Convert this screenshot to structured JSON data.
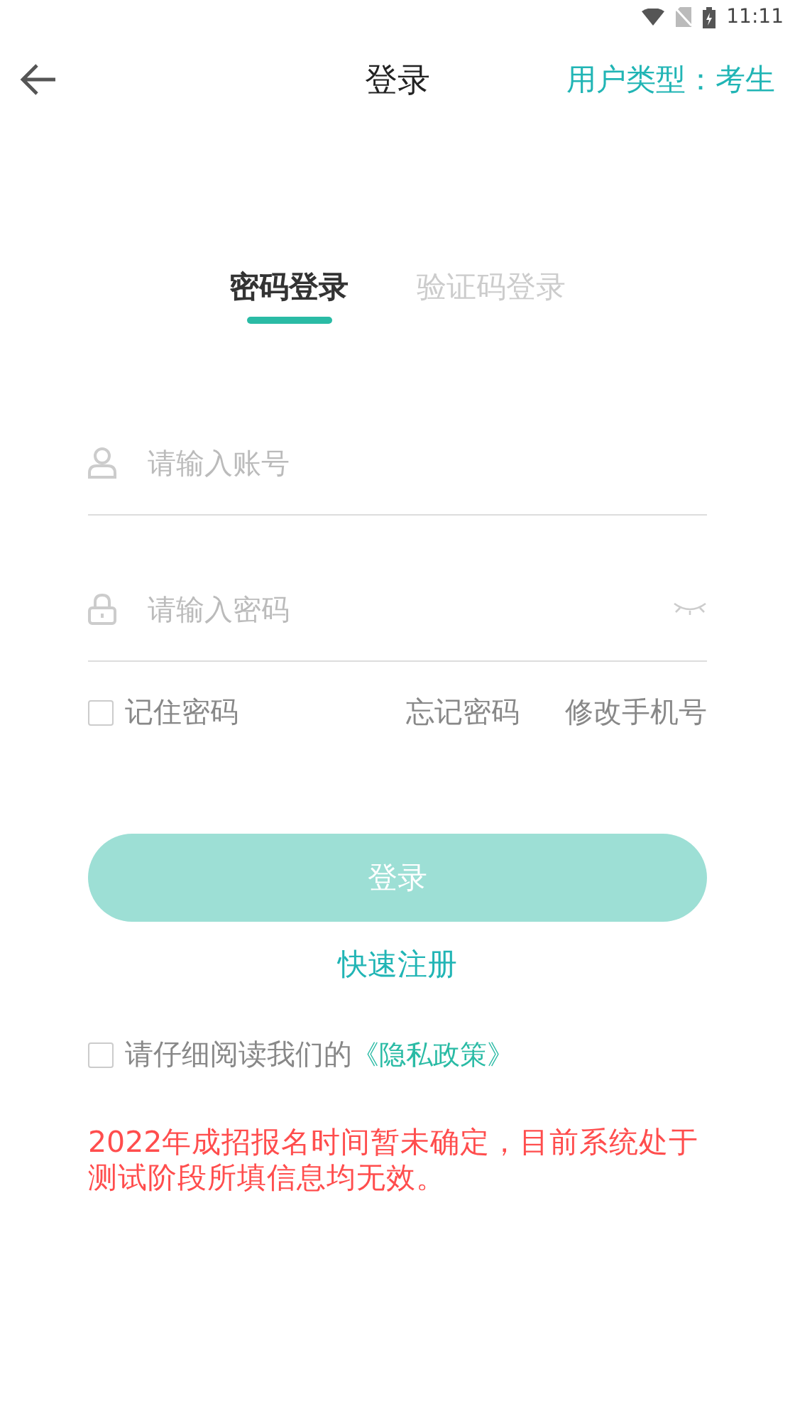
{
  "status_bar": {
    "time": "11:11"
  },
  "header": {
    "title": "登录",
    "user_type": "用户类型：考生"
  },
  "tabs": [
    {
      "label": "密码登录",
      "selected": true
    },
    {
      "label": "验证码登录",
      "selected": false
    }
  ],
  "fields": [
    {
      "kind": "account",
      "placeholder": "请输入账号"
    },
    {
      "kind": "password",
      "placeholder": "请输入密码"
    }
  ],
  "remember": {
    "label": "记住密码",
    "checked": false
  },
  "links": [
    "忘记密码",
    "修改手机号"
  ],
  "login_button": {
    "label": "登录",
    "disabled": true
  },
  "register_link": "快速注册",
  "privacy": {
    "checked": false,
    "text": "请仔细阅读我们的",
    "link": "《隐私政策》"
  },
  "notice": "2022年成招报名时间暂未确定，目前系统处于测试阶段所填信息均无效。"
}
